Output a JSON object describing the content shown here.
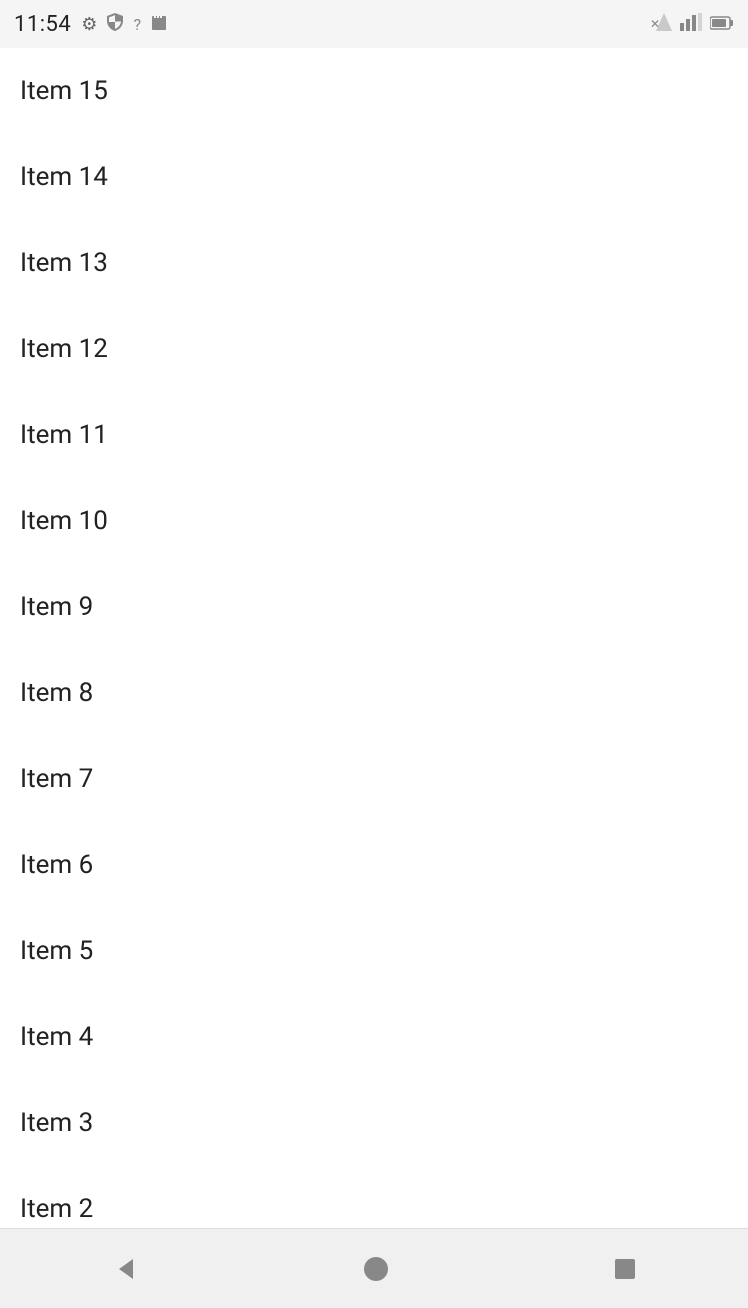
{
  "statusBar": {
    "time": "11:54",
    "icons": [
      "gear",
      "shield",
      "wifi",
      "sd-card"
    ],
    "rightIcons": [
      "signal-x",
      "signal-bars",
      "battery"
    ]
  },
  "list": {
    "items": [
      {
        "label": "Item 15"
      },
      {
        "label": "Item 14"
      },
      {
        "label": "Item 13"
      },
      {
        "label": "Item 12"
      },
      {
        "label": "Item 11"
      },
      {
        "label": "Item 10"
      },
      {
        "label": "Item 9"
      },
      {
        "label": "Item 8"
      },
      {
        "label": "Item 7"
      },
      {
        "label": "Item 6"
      },
      {
        "label": "Item 5"
      },
      {
        "label": "Item 4"
      },
      {
        "label": "Item 3"
      },
      {
        "label": "Item 2"
      }
    ]
  },
  "navBar": {
    "back_label": "◀",
    "home_label": "●",
    "recents_label": "■"
  }
}
